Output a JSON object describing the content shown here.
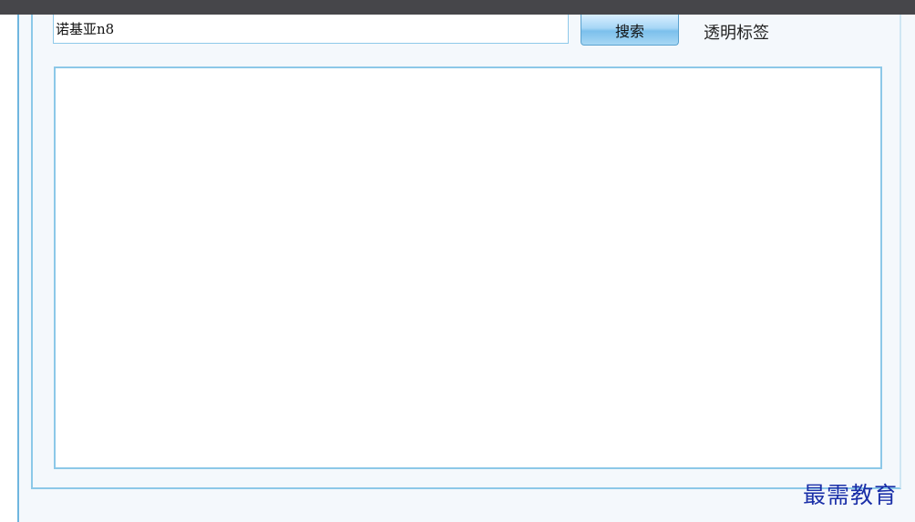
{
  "search": {
    "query": "诺基亚n8",
    "button_label": "搜索"
  },
  "tag": {
    "label": "透明标签"
  },
  "results": {
    "items": []
  },
  "watermark": {
    "text": "最需教育"
  },
  "colors": {
    "topbar": "#46464a",
    "border_accent": "#8cc8e8",
    "button_gradient_mid": "#7cc0ec",
    "panel_bg": "#f4f8fc",
    "watermark": "#1a2fa8"
  }
}
